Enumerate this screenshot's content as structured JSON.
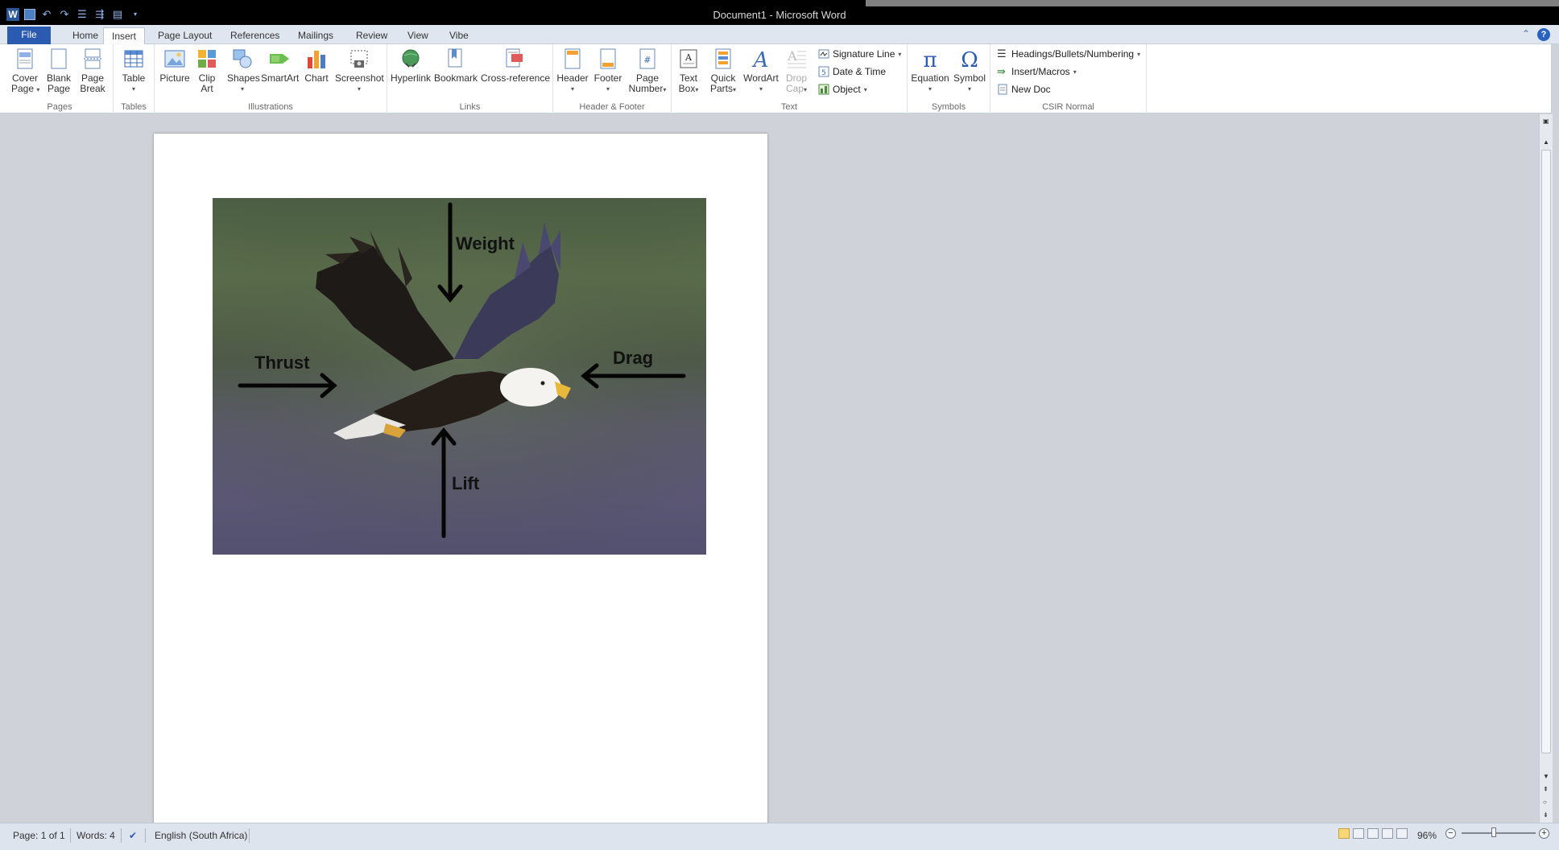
{
  "window": {
    "title": "Document1 - Microsoft Word",
    "app_icon_letter": "W"
  },
  "tabs": [
    {
      "label": "File"
    },
    {
      "label": "Home"
    },
    {
      "label": "Insert"
    },
    {
      "label": "Page Layout"
    },
    {
      "label": "References"
    },
    {
      "label": "Mailings"
    },
    {
      "label": "Review"
    },
    {
      "label": "View"
    },
    {
      "label": "Vibe"
    }
  ],
  "active_tab": "Insert",
  "ribbon": {
    "groups": {
      "pages": "Pages",
      "tables": "Tables",
      "illustrations": "Illustrations",
      "links": "Links",
      "header_footer": "Header & Footer",
      "text": "Text",
      "symbols": "Symbols",
      "csir": "CSIR Normal"
    },
    "buttons": {
      "cover_page": [
        "Cover",
        "Page"
      ],
      "blank_page": [
        "Blank",
        "Page"
      ],
      "page_break": [
        "Page",
        "Break"
      ],
      "table": "Table",
      "picture": "Picture",
      "clip_art": [
        "Clip",
        "Art"
      ],
      "shapes": "Shapes",
      "smartart": "SmartArt",
      "chart": "Chart",
      "screenshot": "Screenshot",
      "hyperlink": "Hyperlink",
      "bookmark": "Bookmark",
      "cross_reference": "Cross-reference",
      "header": "Header",
      "footer": "Footer",
      "page_number": [
        "Page",
        "Number"
      ],
      "text_box": [
        "Text",
        "Box"
      ],
      "quick_parts": [
        "Quick",
        "Parts"
      ],
      "wordart": "WordArt",
      "drop_cap": [
        "Drop",
        "Cap"
      ],
      "signature_line": "Signature Line",
      "date_time": "Date & Time",
      "object": "Object",
      "equation": "Equation",
      "symbol": "Symbol",
      "headings_bullets": "Headings/Bullets/Numbering",
      "insert_macros": "Insert/Macros",
      "new_doc": "New Doc"
    }
  },
  "document": {
    "image_labels": {
      "weight": "Weight",
      "thrust": "Thrust",
      "drag": "Drag",
      "lift": "Lift"
    }
  },
  "status": {
    "page": "Page: 1 of 1",
    "words": "Words: 4",
    "language": "English (South Africa)",
    "zoom": "96%"
  },
  "colors": {
    "file_tab": "#2a5bb0",
    "title_bar": "#000000",
    "ribbon_bg": "#ffffff",
    "doc_bg": "#cfd3d9"
  }
}
